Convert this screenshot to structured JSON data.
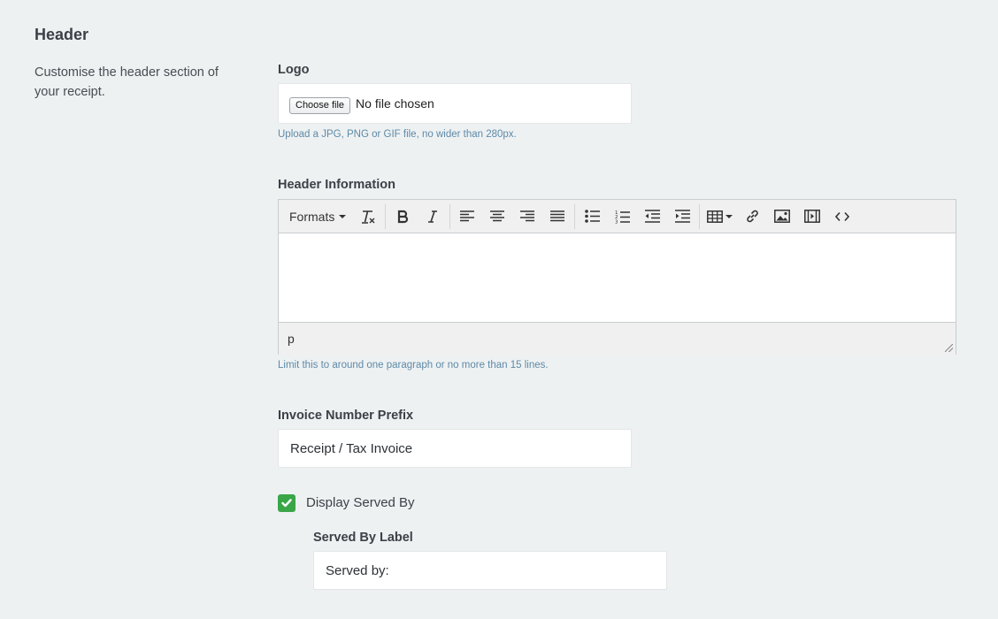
{
  "section": {
    "title": "Header",
    "description": "Customise the header section of your receipt."
  },
  "logo": {
    "label": "Logo",
    "choose_button": "Choose file",
    "no_file_text": "No file chosen",
    "help": "Upload a JPG, PNG or GIF file, no wider than 280px."
  },
  "header_info": {
    "label": "Header Information",
    "formats_label": "Formats",
    "status_path": "p",
    "help": "Limit this to around one paragraph or no more than 15 lines.",
    "toolbar_icons": [
      "clear-formatting-icon",
      "bold-icon",
      "italic-icon",
      "align-left-icon",
      "align-center-icon",
      "align-right-icon",
      "align-justify-icon",
      "bullet-list-icon",
      "numbered-list-icon",
      "outdent-icon",
      "indent-icon",
      "table-icon",
      "link-icon",
      "image-icon",
      "media-icon",
      "source-code-icon"
    ]
  },
  "invoice_prefix": {
    "label": "Invoice Number Prefix",
    "value": "Receipt / Tax Invoice"
  },
  "served_by": {
    "checkbox_label": "Display Served By",
    "checked": true,
    "label": "Served By Label",
    "value": "Served by:"
  },
  "colors": {
    "background": "#eef1f2",
    "help_text": "#5d8aa8",
    "checkbox": "#3aa648"
  }
}
